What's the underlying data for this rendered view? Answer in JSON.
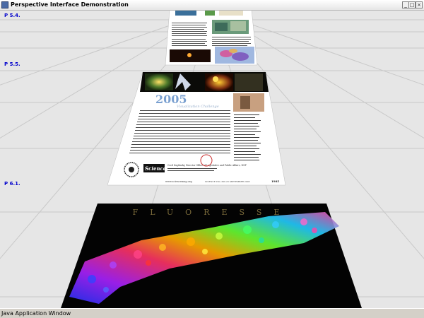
{
  "window": {
    "title": "Perspective Interface Demonstration",
    "controls": [
      "minimize",
      "maximize",
      "close"
    ],
    "status": "Java Application Window"
  },
  "pages": [
    {
      "label": "P 5.4."
    },
    {
      "label": "P 5.5."
    },
    {
      "label": "P 6.1."
    }
  ],
  "page55": {
    "year": "2005",
    "banner": "Visualization Challenge",
    "logo": "Science",
    "credit": "Cecil Kaplinsky Director Office of Legislative and Public Affairs, NSF",
    "footer_left": "www.sciencemag.org",
    "footer_mid": "SCIENCE    VOL 309    23 SEPTEMBER 2005",
    "page_number": "1985"
  },
  "page61": {
    "title": "FLUORESSE"
  },
  "colors": {
    "titlebar": "#e6e6e6",
    "viewport": "#e6e6e6",
    "label": "#0000cc",
    "grid": "#c8c8c8"
  }
}
